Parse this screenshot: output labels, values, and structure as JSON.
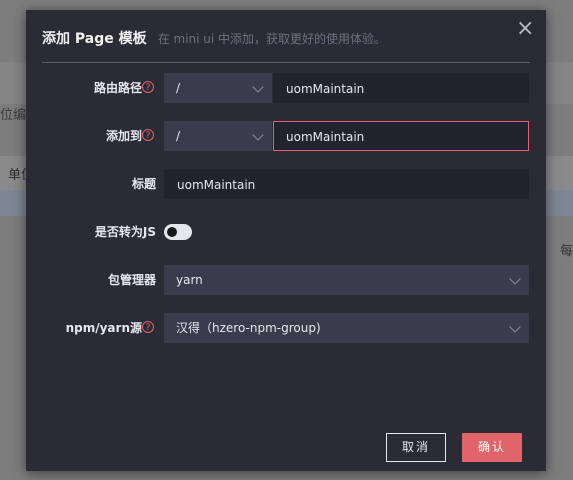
{
  "background": {
    "left_fragment": "位编号",
    "table_header_fragment": "单位",
    "right_fragment": "每"
  },
  "modal": {
    "title": "添加 Page 模板",
    "subtitle": "在 mini ui 中添加，获取更好的使用体验。",
    "close_icon": "×"
  },
  "form": {
    "route_path": {
      "label": "路由路径",
      "help_icon": "?",
      "prefix_value": "/",
      "value": "uomMaintain"
    },
    "add_to": {
      "label": "添加到",
      "help_icon": "?",
      "prefix_value": "/",
      "value": "uomMaintain"
    },
    "title": {
      "label": "标题",
      "value": "uomMaintain"
    },
    "convert_js": {
      "label": "是否转为JS",
      "enabled": false
    },
    "package_manager": {
      "label": "包管理器",
      "value": "yarn"
    },
    "registry": {
      "label": "npm/yarn源",
      "help_icon": "?",
      "value": "汉得（hzero-npm-group)"
    }
  },
  "footer": {
    "cancel_label": "取消",
    "ok_label": "确认"
  },
  "colors": {
    "modal_bg": "#2b2b36",
    "select_bg": "#3b3b4d",
    "input_bg": "#23232d",
    "accent": "#e0646a",
    "text": "#e6e6ee"
  }
}
